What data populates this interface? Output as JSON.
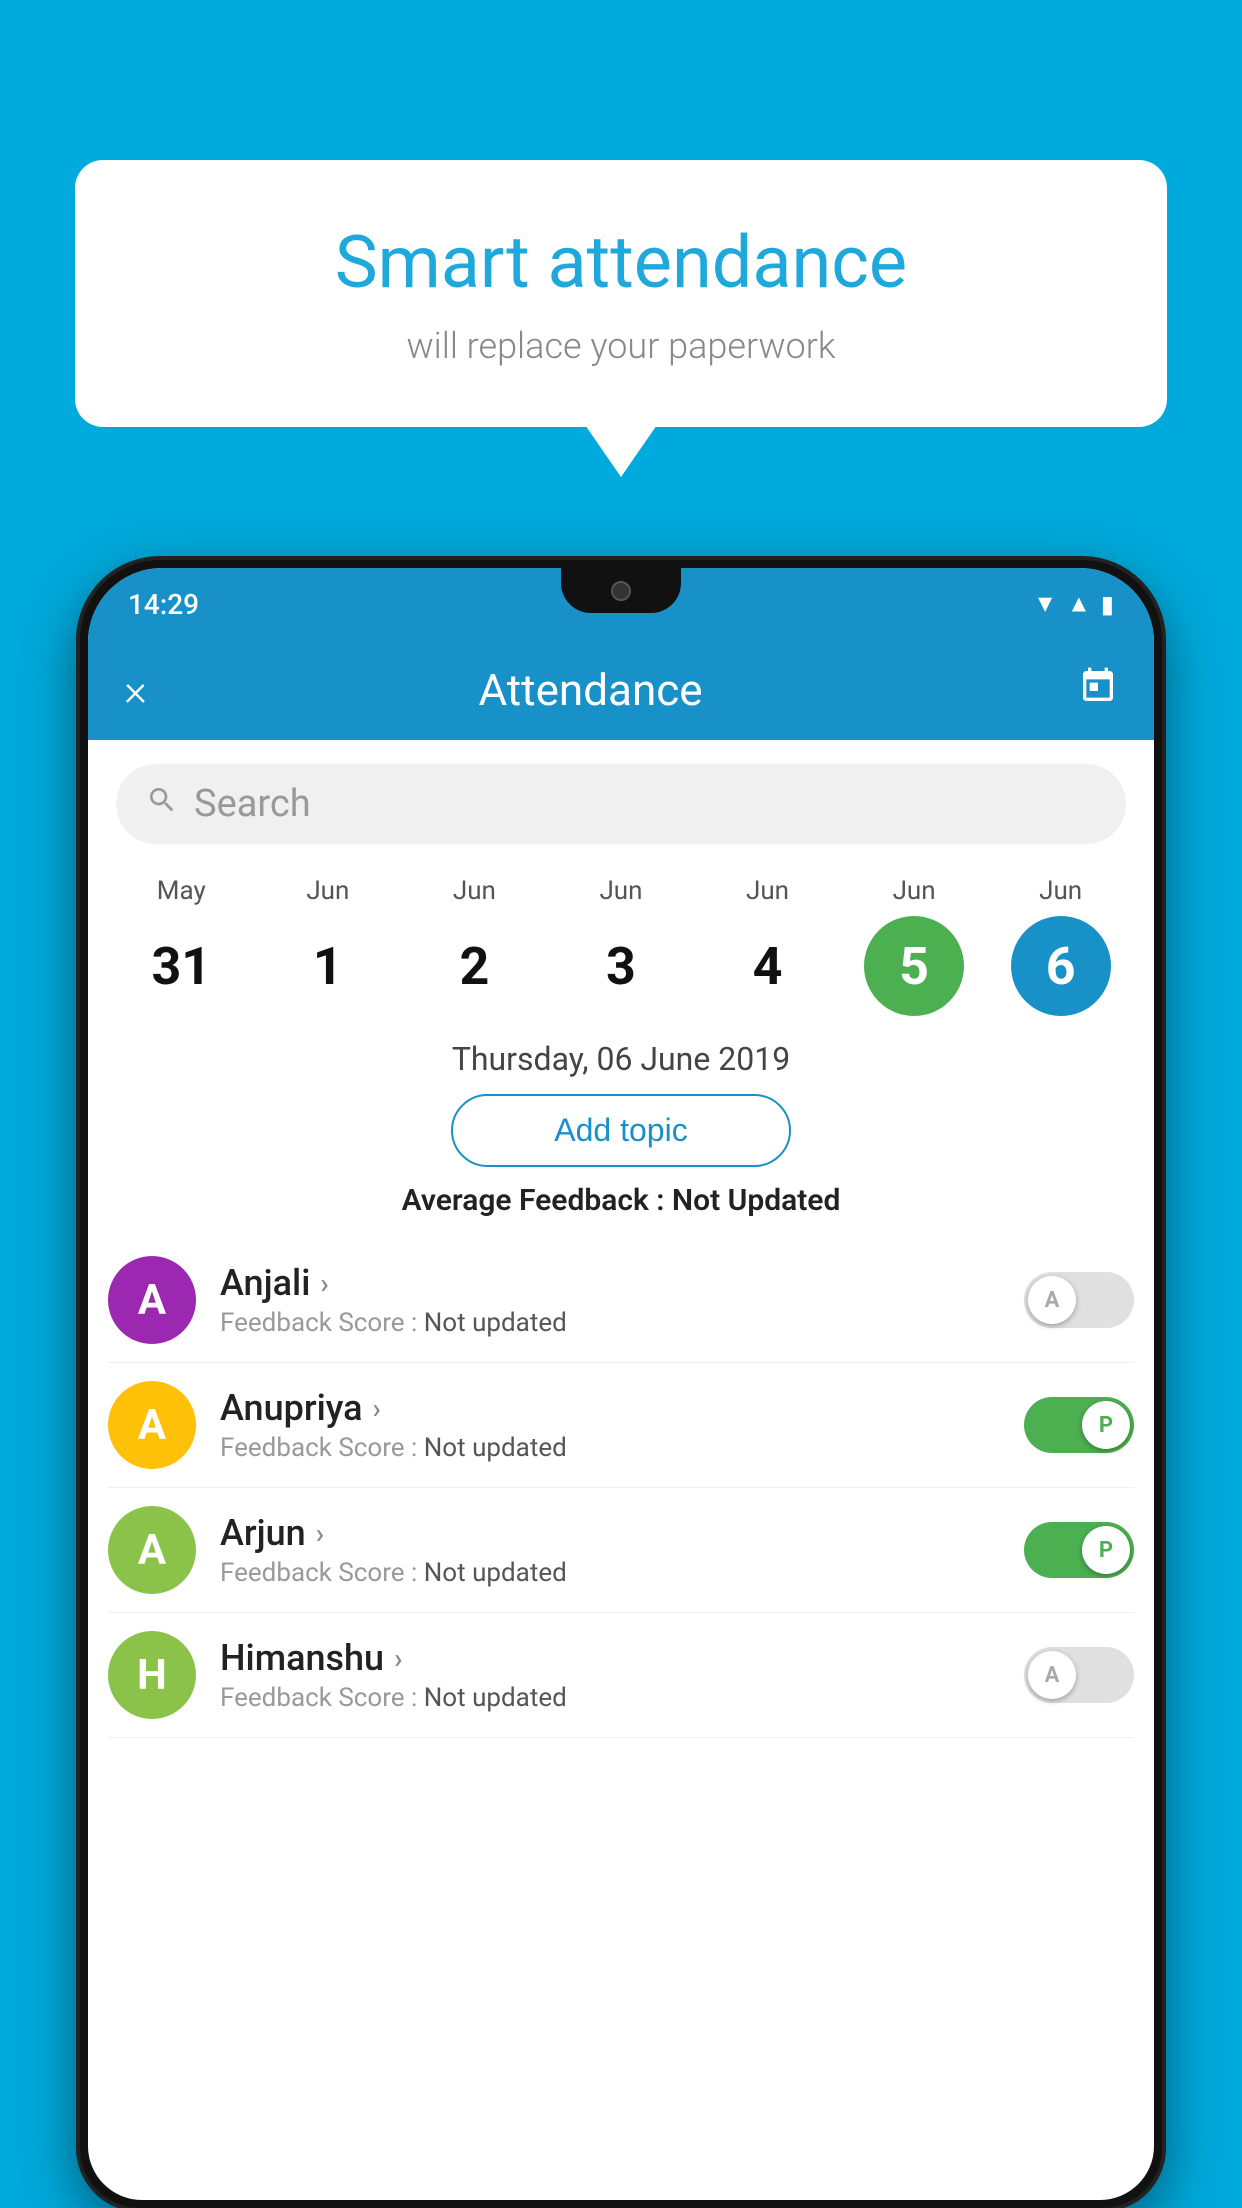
{
  "background": {
    "color": "#00AADC"
  },
  "bubble": {
    "title": "Smart attendance",
    "subtitle": "will replace your paperwork"
  },
  "statusBar": {
    "time": "14:29",
    "icons": [
      "wifi",
      "signal",
      "battery"
    ]
  },
  "appBar": {
    "close_label": "×",
    "title": "Attendance",
    "calendar_icon": "📅"
  },
  "search": {
    "placeholder": "Search"
  },
  "calendar": {
    "days": [
      {
        "month": "May",
        "num": "31",
        "state": "normal"
      },
      {
        "month": "Jun",
        "num": "1",
        "state": "normal"
      },
      {
        "month": "Jun",
        "num": "2",
        "state": "normal"
      },
      {
        "month": "Jun",
        "num": "3",
        "state": "normal"
      },
      {
        "month": "Jun",
        "num": "4",
        "state": "normal"
      },
      {
        "month": "Jun",
        "num": "5",
        "state": "today"
      },
      {
        "month": "Jun",
        "num": "6",
        "state": "selected"
      }
    ]
  },
  "selectedDate": "Thursday, 06 June 2019",
  "addTopic": "Add topic",
  "feedbackAvg": {
    "label": "Average Feedback : ",
    "value": "Not Updated"
  },
  "students": [
    {
      "name": "Anjali",
      "initial": "A",
      "avatarColor": "#9C27B0",
      "feedback": "Feedback Score : ",
      "feedbackVal": "Not updated",
      "toggleState": "off",
      "toggleLabel": "A"
    },
    {
      "name": "Anupriya",
      "initial": "A",
      "avatarColor": "#FFC107",
      "feedback": "Feedback Score : ",
      "feedbackVal": "Not updated",
      "toggleState": "on-p",
      "toggleLabel": "P"
    },
    {
      "name": "Arjun",
      "initial": "A",
      "avatarColor": "#8BC34A",
      "feedback": "Feedback Score : ",
      "feedbackVal": "Not updated",
      "toggleState": "on-p",
      "toggleLabel": "P"
    },
    {
      "name": "Himanshu",
      "initial": "H",
      "avatarColor": "#8BC34A",
      "feedback": "Feedback Score : ",
      "feedbackVal": "Not updated",
      "toggleState": "off",
      "toggleLabel": "A"
    }
  ]
}
